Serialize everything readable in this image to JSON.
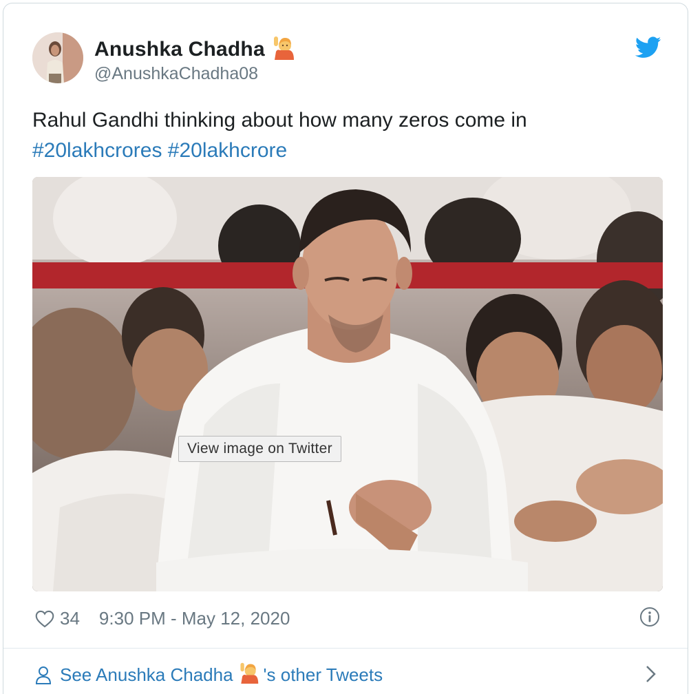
{
  "author": {
    "name": "Anushka Chadha",
    "name_emoji": "person-raising-hand-emoji",
    "handle": "@AnushkaChadha08"
  },
  "tweet": {
    "text": "Rahul Gandhi thinking about how many zeros come in",
    "hashtags": [
      "#20lakhcrores",
      "#20lakhcrore"
    ]
  },
  "media": {
    "view_button_label": "View image on Twitter"
  },
  "meta": {
    "likes": "34",
    "timestamp": "9:30 PM - May 12, 2020"
  },
  "footer": {
    "prefix": "See Anushka Chadha",
    "suffix": "'s other Tweets"
  },
  "colors": {
    "link": "#2b7bb9",
    "secondary": "#697882",
    "twitter_blue": "#1da1f2"
  },
  "icons": [
    "twitter-bird-icon",
    "heart-icon",
    "info-icon",
    "user-icon",
    "chevron-right-icon"
  ]
}
